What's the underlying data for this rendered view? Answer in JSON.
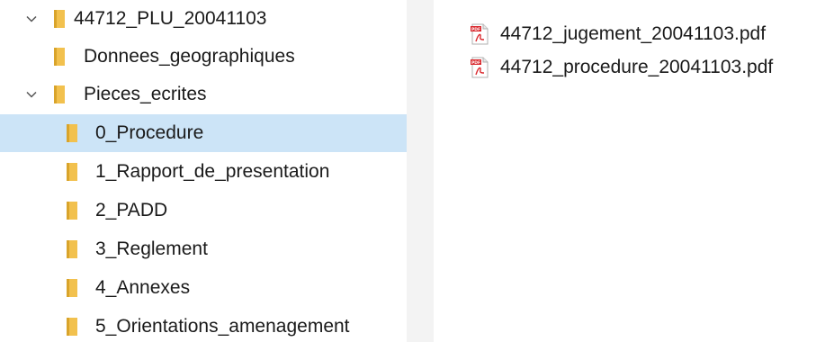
{
  "navigation_tree": {
    "items": [
      {
        "label": "44712_PLU_20041103",
        "expanded": true
      },
      {
        "label": "Donnees_geographiques"
      },
      {
        "label": "Pieces_ecrites",
        "expanded": true
      },
      {
        "label": "0_Procedure",
        "selected": true
      },
      {
        "label": "1_Rapport_de_presentation"
      },
      {
        "label": "2_PADD"
      },
      {
        "label": "3_Reglement"
      },
      {
        "label": "4_Annexes"
      },
      {
        "label": "5_Orientations_amenagement"
      }
    ]
  },
  "file_list": {
    "items": [
      {
        "name": "44712_jugement_20041103.pdf",
        "icon": "pdf-file-icon"
      },
      {
        "name": "44712_procedure_20041103.pdf",
        "icon": "pdf-file-icon"
      }
    ]
  },
  "colors": {
    "selection": "#cce4f7",
    "folder": "#f2c14e",
    "folder_dark": "#d9a42b",
    "pdf_red": "#d9262b",
    "splitter": "#f3f3f3"
  }
}
